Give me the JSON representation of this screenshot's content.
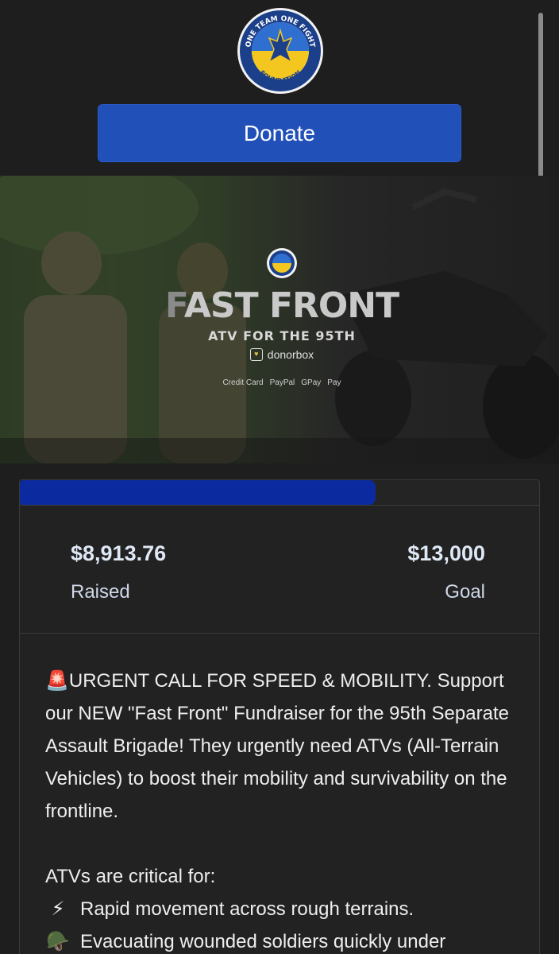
{
  "logo": {
    "top_text": "ONE TEAM ONE FIGHT",
    "bottom_text": "FOUNDATION"
  },
  "donate_button": {
    "label": "Donate"
  },
  "banner": {
    "title_part1": "F",
    "title_part2": "AST FRONT",
    "subtitle": "ATV FOR THE 95TH",
    "provider": "donorbox",
    "payment_methods": [
      "Credit Card",
      "PayPal",
      "GPay",
      "Pay"
    ]
  },
  "campaign": {
    "progress_fraction": 0.6857,
    "raised_amount": "$8,913.76",
    "raised_label": "Raised",
    "goal_amount": "$13,000",
    "goal_label": "Goal"
  },
  "description": {
    "paragraph1_icon": "🚨",
    "paragraph1": "URGENT CALL FOR SPEED & MOBILITY. Support our NEW \"Fast Front\" Fundraiser for the 95th Separate Assault Brigade! They urgently need ATVs (All-Terrain Vehicles) to boost their mobility and survivability on the frontline.",
    "list_intro": "ATVs are critical for:",
    "list_items": [
      {
        "icon": "⚡",
        "text": "Rapid movement across rough terrains."
      },
      {
        "icon": "🪖",
        "text": "Evacuating wounded soldiers quickly under"
      }
    ]
  },
  "colors": {
    "background": "#1e1e1e",
    "donate_button": "#2050b8",
    "progress_fill": "#0c2aa0",
    "amount_text": "#dfe8f5"
  }
}
